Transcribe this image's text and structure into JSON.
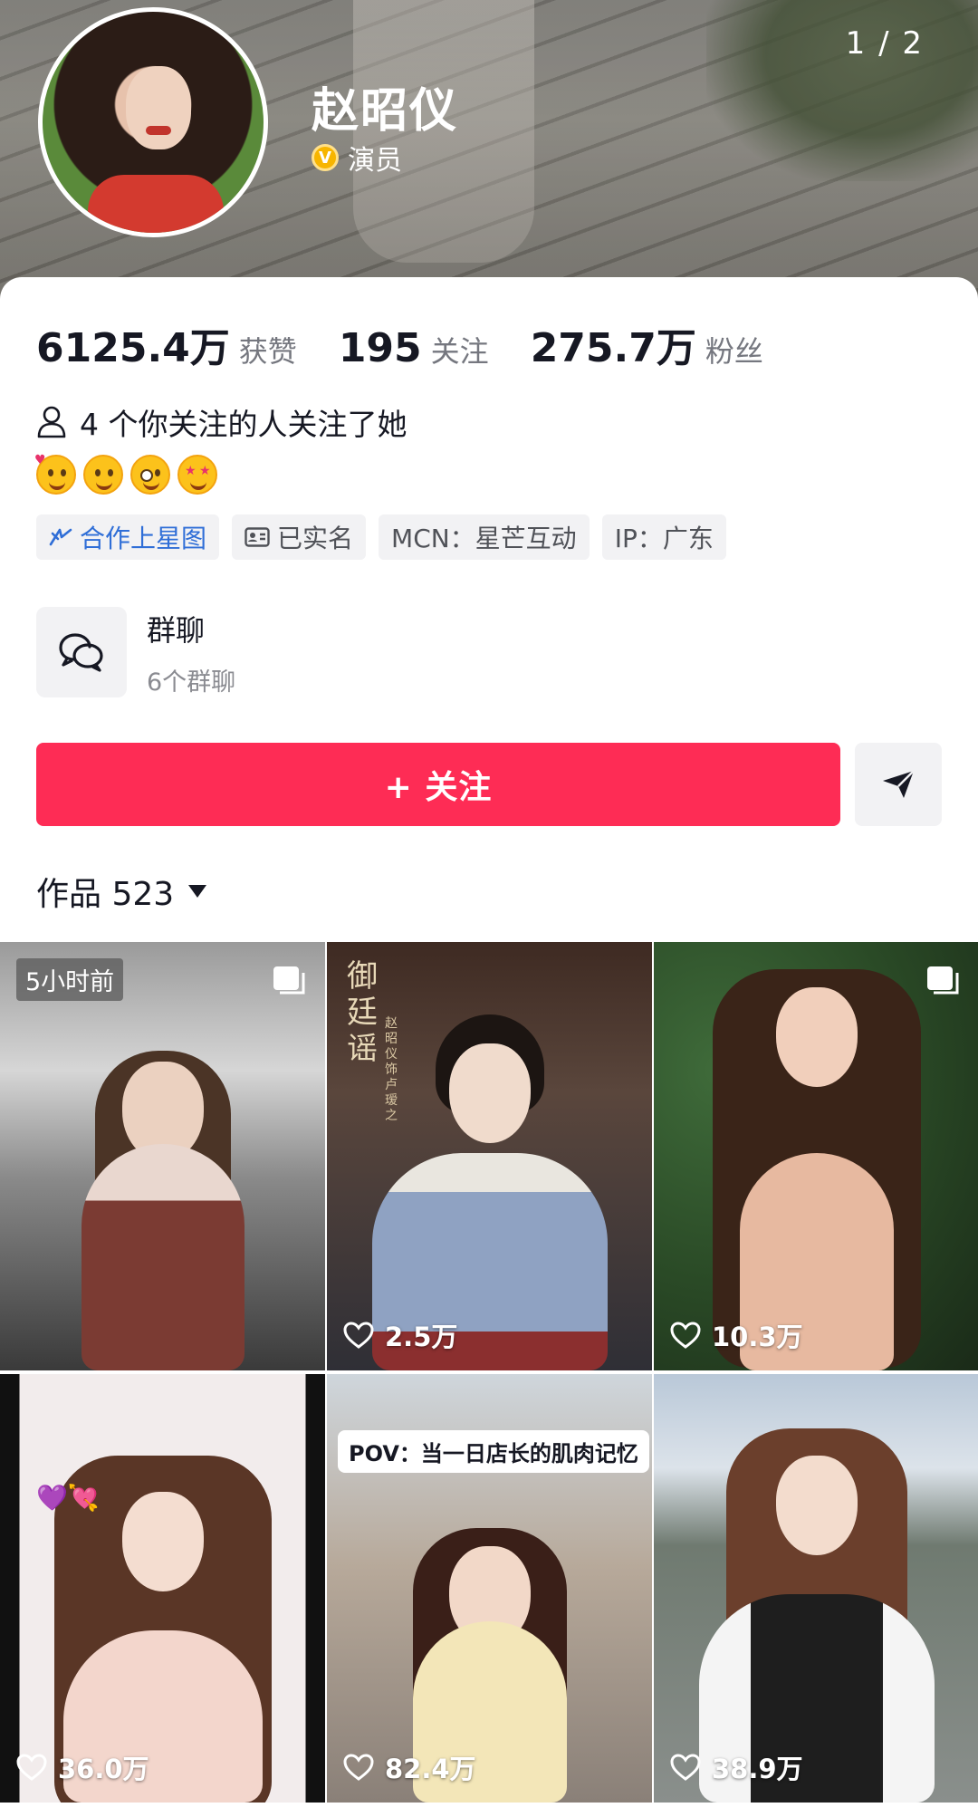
{
  "header": {
    "page_indicator": "1 / 2",
    "name": "赵昭仪",
    "verify_badge": "V",
    "verify_label": "演员"
  },
  "stats": [
    {
      "num": "6125.4万",
      "label": "获赞"
    },
    {
      "num": "195",
      "label": "关注"
    },
    {
      "num": "275.7万",
      "label": "粉丝"
    }
  ],
  "mutual_text": "4 个你关注的人关注了她",
  "emojis": [
    "smiling-face-with-hearts",
    "savoring-face",
    "zany-face",
    "star-struck"
  ],
  "tags": [
    {
      "label": "合作上星图",
      "icon": "star-map-icon"
    },
    {
      "label": "已实名",
      "icon": "id-card-icon"
    },
    {
      "label": "MCN：星芒互动"
    },
    {
      "label": "IP：广东"
    }
  ],
  "group_chat": {
    "title": "群聊",
    "subtitle": "6个群聊",
    "icon": "chat-bubbles-icon"
  },
  "follow_label": "+ 关注",
  "share_icon": "send-icon",
  "works": {
    "label": "作品 523"
  },
  "videos": [
    {
      "likes": "",
      "time": "5小时前",
      "multi": true
    },
    {
      "likes": "2.5万",
      "title": "御廷谣",
      "subtitle": "赵昭仪饰卢瑷之"
    },
    {
      "likes": "10.3万",
      "multi": true
    },
    {
      "likes": "36.0万",
      "decor": "💜💘"
    },
    {
      "likes": "82.4万",
      "overlay": "POV：当一日店长的肌肉记忆"
    },
    {
      "likes": "38.9万"
    }
  ],
  "colors": {
    "accent": "#fe2c55",
    "link_blue": "#2f6ed7",
    "verify_gold": "#f7b500"
  }
}
